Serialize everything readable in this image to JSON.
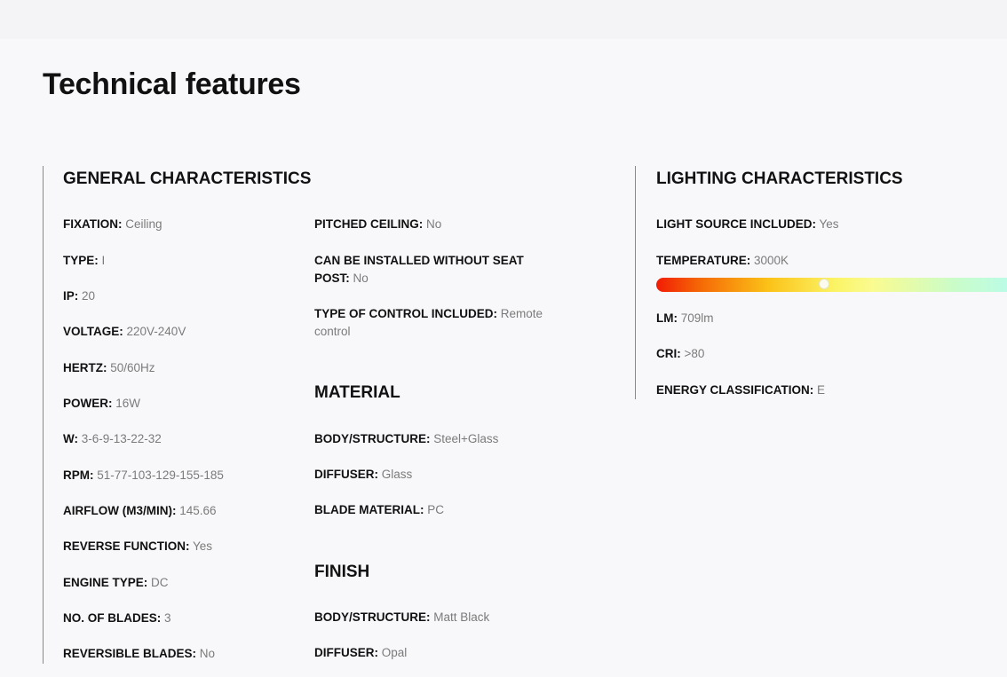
{
  "page_title": "Technical features",
  "general": {
    "title": "GENERAL CHARACTERISTICS",
    "col1": [
      {
        "label": "FIXATION:",
        "value": "Ceiling"
      },
      {
        "label": "TYPE:",
        "value": "I"
      },
      {
        "label": "IP:",
        "value": "20"
      },
      {
        "label": "VOLTAGE:",
        "value": "220V-240V"
      },
      {
        "label": "HERTZ:",
        "value": "50/60Hz"
      },
      {
        "label": "POWER:",
        "value": "16W"
      },
      {
        "label": "W:",
        "value": "3-6-9-13-22-32"
      },
      {
        "label": "RPM:",
        "value": "51-77-103-129-155-185"
      },
      {
        "label": "AIRFLOW (M3/MIN):",
        "value": "145.66"
      },
      {
        "label": "REVERSE FUNCTION:",
        "value": "Yes"
      },
      {
        "label": "ENGINE TYPE:",
        "value": "DC"
      },
      {
        "label": "NO. OF BLADES:",
        "value": "3"
      },
      {
        "label": "REVERSIBLE BLADES:",
        "value": "No"
      }
    ],
    "col2": [
      {
        "label": "PITCHED CEILING:",
        "value": "No"
      },
      {
        "label": "CAN BE INSTALLED WITHOUT SEAT POST:",
        "value": "No"
      },
      {
        "label": "TYPE OF CONTROL INCLUDED:",
        "value": "Remote control"
      }
    ]
  },
  "material": {
    "title": "MATERIAL",
    "items": [
      {
        "label": "BODY/STRUCTURE:",
        "value": "Steel+Glass"
      },
      {
        "label": "DIFFUSER:",
        "value": "Glass"
      },
      {
        "label": "BLADE MATERIAL:",
        "value": "PC"
      }
    ]
  },
  "finish": {
    "title": "FINISH",
    "items": [
      {
        "label": "BODY/STRUCTURE:",
        "value": "Matt Black"
      },
      {
        "label": "DIFFUSER:",
        "value": "Opal"
      }
    ]
  },
  "lighting": {
    "title": "LIGHTING CHARACTERISTICS",
    "items": [
      {
        "label": "LIGHT SOURCE INCLUDED:",
        "value": "Yes"
      },
      {
        "label": "TEMPERATURE:",
        "value": "3000K"
      },
      {
        "label": "LM:",
        "value": "709lm"
      },
      {
        "label": "CRI:",
        "value": ">80"
      },
      {
        "label": "ENERGY CLASSIFICATION:",
        "value": "E"
      }
    ],
    "temperature_slider": {
      "level_fraction": 0.45
    }
  }
}
